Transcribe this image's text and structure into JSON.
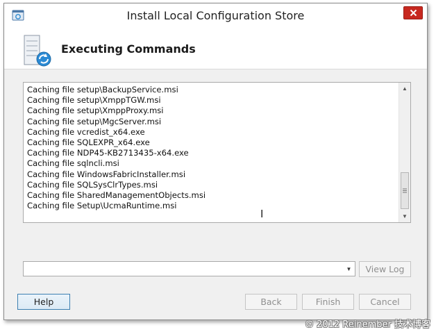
{
  "window": {
    "title": "Install Local Configuration Store",
    "icons": {
      "app": "installer-app-icon",
      "close": "close-icon"
    }
  },
  "header": {
    "title": "Executing Commands",
    "icon": "server-refresh-icon"
  },
  "log": {
    "lines": [
      "Caching file setup\\BackupService.msi",
      "Caching file setup\\XmppTGW.msi",
      "Caching file setup\\XmppProxy.msi",
      "Caching file setup\\MgcServer.msi",
      "Caching file vcredist_x64.exe",
      "Caching file SQLEXPR_x64.exe",
      "Caching file NDP45-KB2713435-x64.exe",
      "Caching file sqlncli.msi",
      "Caching file WindowsFabricInstaller.msi",
      "Caching file SQLSysClrTypes.msi",
      "Caching file SharedManagementObjects.msi",
      "Caching file Setup\\UcmaRuntime.msi"
    ],
    "scroll_position": 1.0
  },
  "combo": {
    "value": ""
  },
  "buttons": {
    "view_log": "View Log",
    "help": "Help",
    "back": "Back",
    "finish": "Finish",
    "cancel": "Cancel"
  },
  "watermark": "© 2012 Reinember 技术博客",
  "colors": {
    "close_button": "#c7281f",
    "dialog_bg": "#f0f0f0",
    "focus_border": "#3c7fb1"
  }
}
